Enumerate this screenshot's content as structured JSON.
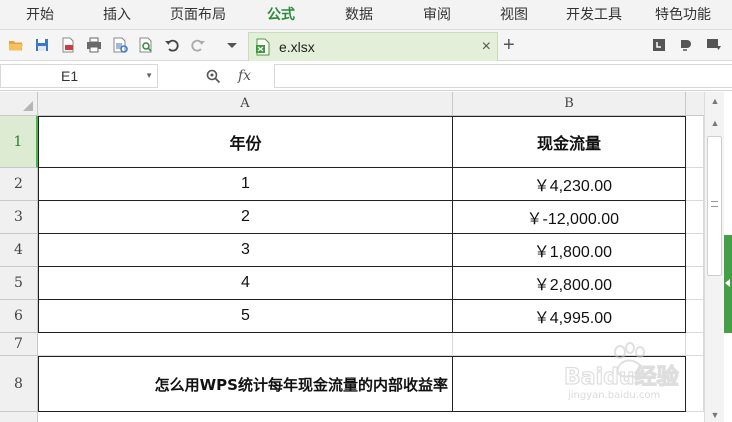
{
  "menu": {
    "items": [
      "开始",
      "插入",
      "页面布局",
      "公式",
      "数据",
      "审阅",
      "视图",
      "开发工具",
      "特色功能"
    ],
    "active": "公式"
  },
  "tab": {
    "filename": "e.xlsx",
    "close": "×",
    "add": "+"
  },
  "formula_bar": {
    "cell_ref": "E1",
    "fx": "fx",
    "value": ""
  },
  "columns": [
    "A",
    "B"
  ],
  "rows": [
    {
      "num": "1",
      "a": "年份",
      "b": "现金流量"
    },
    {
      "num": "2",
      "a": "1",
      "b": "￥4,230.00"
    },
    {
      "num": "3",
      "a": "2",
      "b": "￥-12,000.00"
    },
    {
      "num": "4",
      "a": "3",
      "b": "￥1,800.00"
    },
    {
      "num": "5",
      "a": "4",
      "b": "￥2,800.00"
    },
    {
      "num": "6",
      "a": "5",
      "b": "￥4,995.00"
    },
    {
      "num": "7",
      "a": "",
      "b": ""
    },
    {
      "num": "8",
      "a": "怎么用WPS统计每年现金流量的内部收益率",
      "b": ""
    }
  ],
  "selected_row": "1",
  "watermark": {
    "brand": "Baidu经验",
    "url": "jingyan.baidu.com"
  },
  "colors": {
    "accent": "#2e8b3a",
    "tab_bg": "#e3efd9",
    "side_handle": "#43a047"
  }
}
